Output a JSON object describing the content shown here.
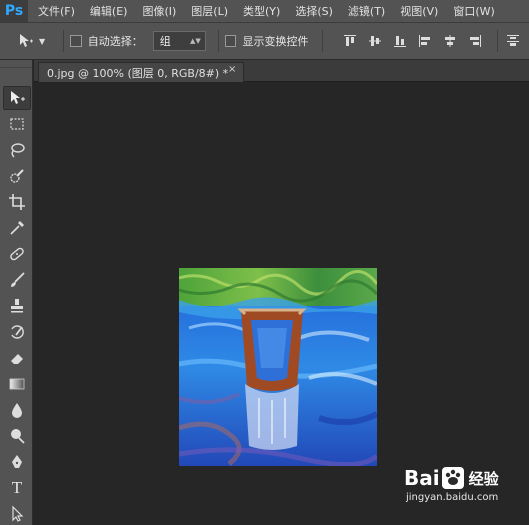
{
  "app": {
    "logo": "Ps"
  },
  "menu": [
    "文件(F)",
    "编辑(E)",
    "图像(I)",
    "图层(L)",
    "类型(Y)",
    "选择(S)",
    "滤镜(T)",
    "视图(V)",
    "窗口(W)"
  ],
  "options": {
    "move_tool_icon": "move-icon",
    "auto_select_label": "自动选择：",
    "auto_select_checked": false,
    "auto_select_value": "组",
    "show_transform_label": "显示变换控件",
    "show_transform_checked": false
  },
  "document": {
    "tab_title": "0.jpg @ 100% (图层 0, RGB/8#) *",
    "close_glyph": "×"
  },
  "tools": [
    "move-icon",
    "marquee-icon",
    "lasso-icon",
    "quick-select-icon",
    "crop-icon",
    "eyedropper-icon",
    "healing-brush-icon",
    "brush-icon",
    "clone-stamp-icon",
    "history-brush-icon",
    "eraser-icon",
    "gradient-icon",
    "blur-icon",
    "dodge-icon",
    "pen-icon",
    "type-icon",
    "path-select-icon"
  ],
  "type_tool_label": "T",
  "watermark": {
    "brand_left": "Bai",
    "brand_right": "经验",
    "url": "jingyan.baidu.com"
  },
  "colors": {
    "menubar": "#535353",
    "workspace": "#262626",
    "ps_blue": "#31a8ff"
  }
}
